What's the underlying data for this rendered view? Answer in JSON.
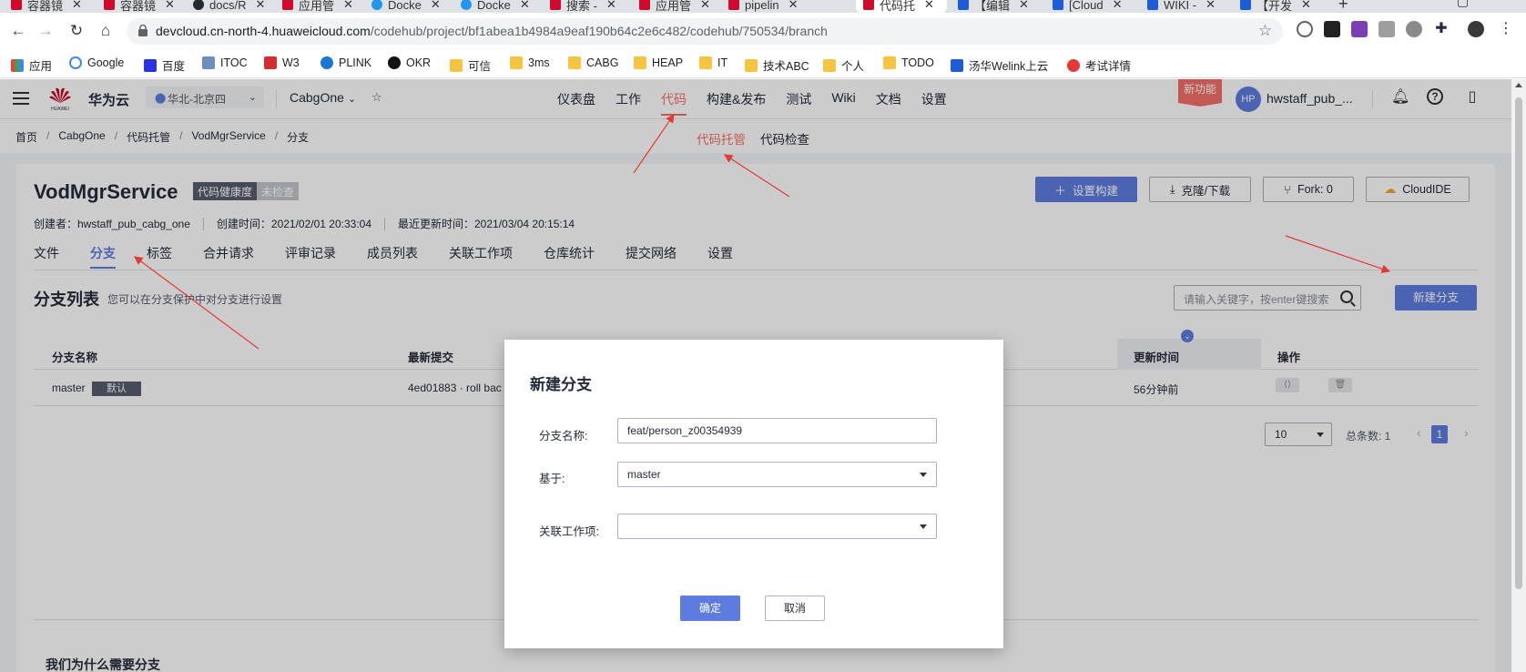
{
  "browser": {
    "tabs": [
      {
        "label": "容器镜",
        "icon": "huawei-icon"
      },
      {
        "label": "容器镜",
        "icon": "huawei-icon"
      },
      {
        "label": "docs/R",
        "icon": "github-icon"
      },
      {
        "label": "应用管",
        "icon": "huawei-icon"
      },
      {
        "label": "Docke",
        "icon": "docker-icon"
      },
      {
        "label": "Docke",
        "icon": "docker-icon"
      },
      {
        "label": "搜索 -",
        "icon": "huawei-icon"
      },
      {
        "label": "应用管",
        "icon": "huawei-icon"
      },
      {
        "label": "pipelin",
        "icon": "huawei-icon"
      },
      {
        "label": "代码托",
        "icon": "huawei-icon",
        "active": true
      },
      {
        "label": "【编辑",
        "icon": "welink-icon"
      },
      {
        "label": "[Cloud",
        "icon": "welink-icon"
      },
      {
        "label": "WIKI -",
        "icon": "welink-icon"
      },
      {
        "label": "【开发",
        "icon": "welink-icon"
      }
    ],
    "new_tab": "+",
    "url_host": "devcloud.cn-north-4.huaweicloud.com",
    "url_path": "/codehub/project/bf1abea1b4984a9eaf190b64c2e6c482/codehub/750534/branch",
    "bookmarks": [
      "应用",
      "Google",
      "百度",
      "ITOC",
      "W3",
      "PLINK",
      "OKR",
      "可信",
      "3ms",
      "CABG",
      "HEAP",
      "IT",
      "技术ABC",
      "个人",
      "TODO",
      "汤华Welink上云",
      "考试详情"
    ]
  },
  "header": {
    "logo_text": "HUAWEI",
    "brand": "华为云",
    "region": "华北-北京四",
    "project": "CabgOne",
    "nav": [
      "仪表盘",
      "工作",
      "代码",
      "构建&发布",
      "测试",
      "Wiki",
      "文档",
      "设置"
    ],
    "active_nav": "代码",
    "new_feature": "新功能",
    "avatar": "HP",
    "username": "hwstaff_pub_..."
  },
  "breadcrumb": [
    "首页",
    "CabgOne",
    "代码托管",
    "VodMgrService",
    "分支"
  ],
  "code_subtabs": [
    "代码托管",
    "代码检查"
  ],
  "repo": {
    "name": "VodMgrService",
    "health_label": "代码健康度",
    "health_value": "未检查",
    "creator": "创建者：hwstaff_pub_cabg_one",
    "created": "创建时间：2021/02/01 20:33:04",
    "updated": "最近更新时间：2021/03/04 20:15:14",
    "buttons": {
      "setup_build": "设置构建",
      "clone": "克隆/下载",
      "fork": "Fork: 0",
      "cloudide": "CloudIDE"
    },
    "tabs": [
      "文件",
      "分支",
      "标签",
      "合并请求",
      "评审记录",
      "成员列表",
      "关联工作项",
      "仓库统计",
      "提交网络",
      "设置"
    ],
    "active_tab": "分支"
  },
  "branches": {
    "title": "分支列表",
    "desc": "您可以在分支保护中对分支进行设置",
    "search_placeholder": "请输入关键字，按enter键搜索",
    "new_button": "新建分支",
    "columns": [
      "分支名称",
      "最新提交",
      "更新时间",
      "操作"
    ],
    "rows": [
      {
        "name": "master",
        "badge": "默认",
        "commit": "4ed01883 · roll bac",
        "updated": "56分钟前"
      }
    ],
    "page_size": "10",
    "total": "总条数: 1",
    "page": "1"
  },
  "why_title": "我们为什么需要分支",
  "modal": {
    "title": "新建分支",
    "name_label": "分支名称:",
    "name_value": "feat/person_z00354939",
    "base_label": "基于:",
    "base_value": "master",
    "workitem_label": "关联工作项:",
    "workitem_value": "",
    "ok": "确定",
    "cancel": "取消"
  },
  "colors": {
    "accent": "#5e7ce0",
    "active_red": "#f66f6a",
    "annotation_arrow": "#e53935"
  }
}
